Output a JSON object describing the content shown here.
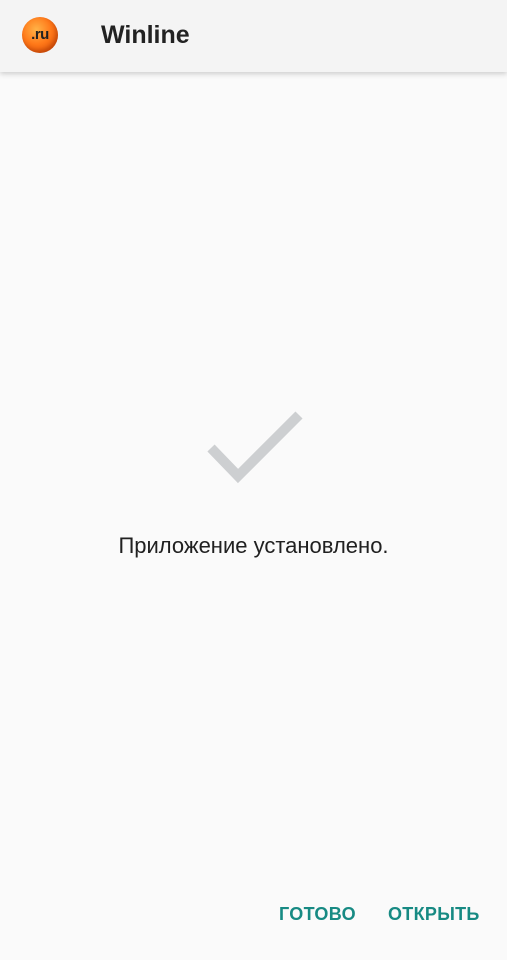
{
  "app_bar": {
    "icon_text": ".ru",
    "icon_name": "app-logo-icon",
    "title": "Winline"
  },
  "main": {
    "status_icon": "checkmark-icon",
    "status_message": "Приложение установлено."
  },
  "actions": {
    "done_label": "ГОТОВО",
    "open_label": "ОТКРЫТЬ"
  },
  "colors": {
    "background": "#fafafa",
    "app_bar": "#f4f4f4",
    "accent": "#178a83",
    "checkmark": "#cdcfd1",
    "text": "#202020"
  }
}
